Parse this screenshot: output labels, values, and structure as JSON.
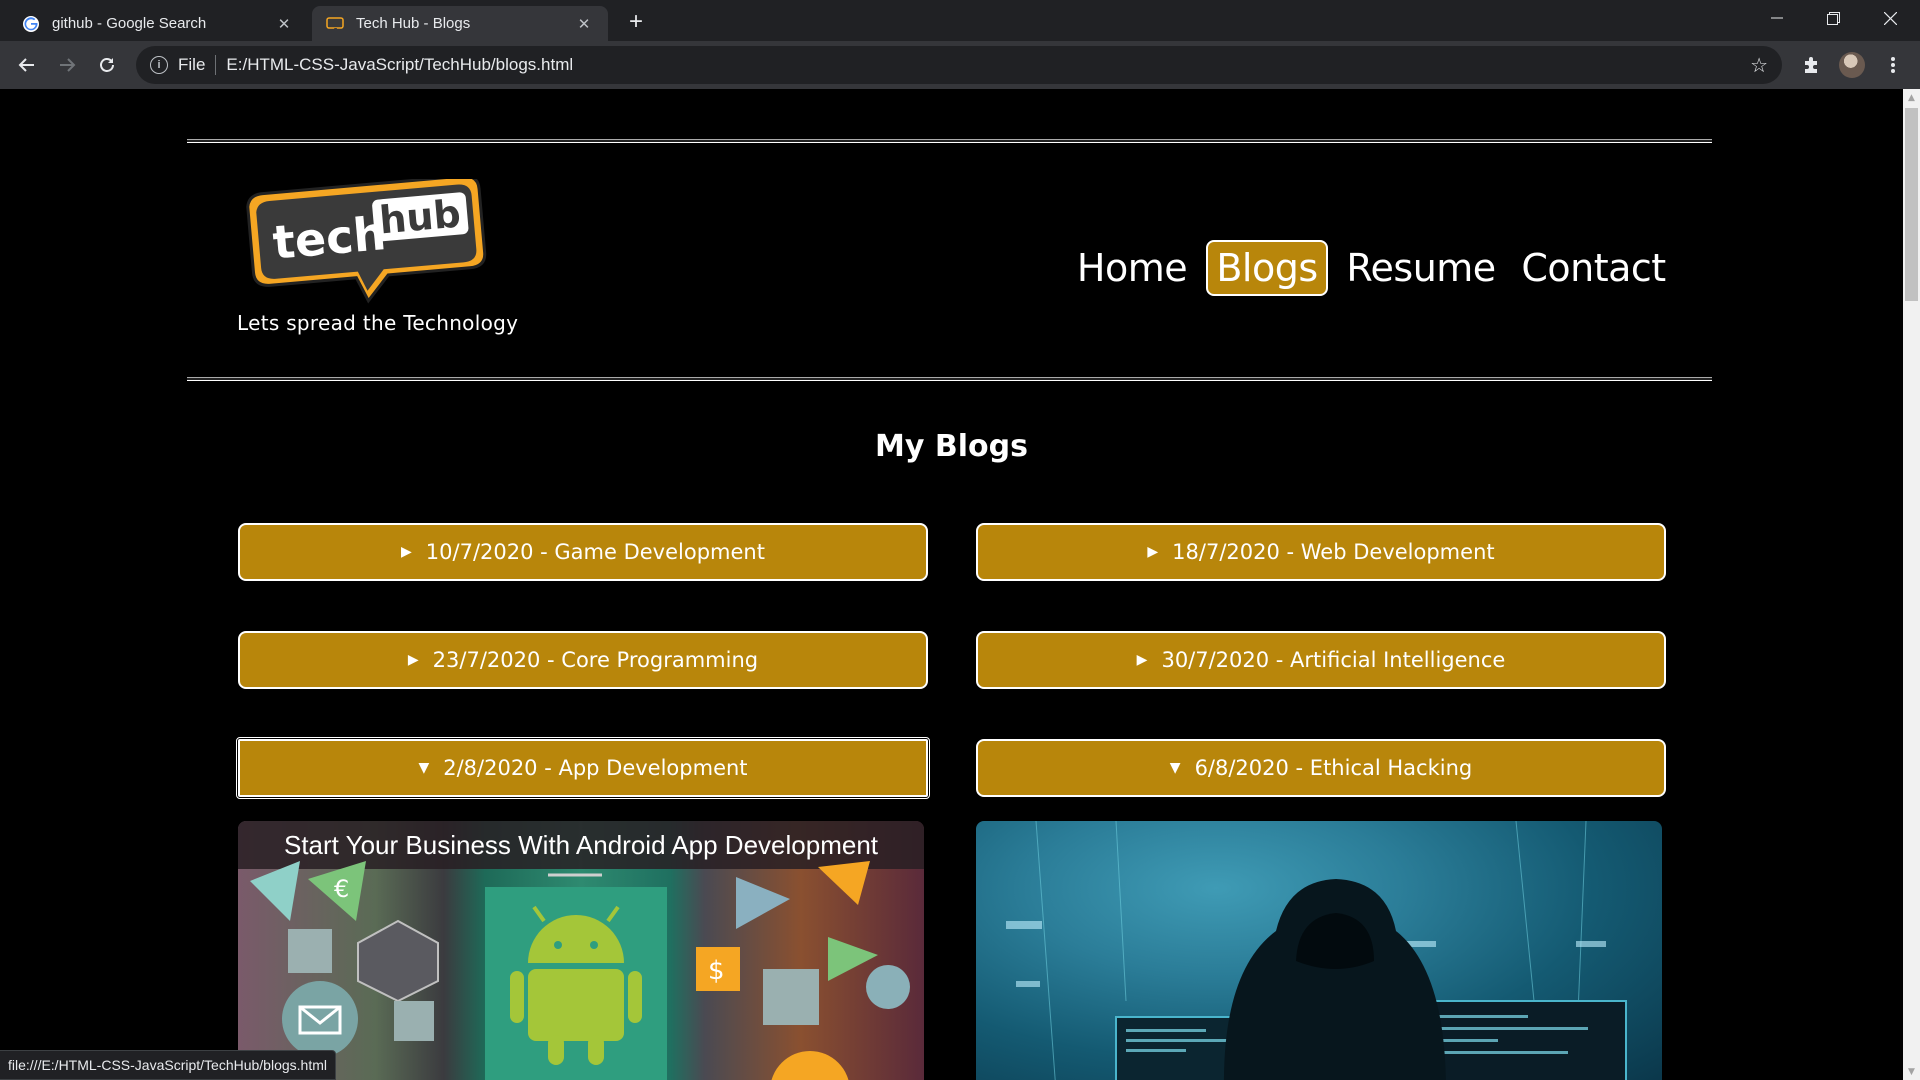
{
  "browser": {
    "tabs": [
      {
        "title": "github - Google Search",
        "active": false,
        "icon": "google-icon"
      },
      {
        "title": "Tech Hub - Blogs",
        "active": true,
        "icon": "techhub-favicon"
      }
    ],
    "address": {
      "scheme": "File",
      "url": "E:/HTML-CSS-JavaScript/TechHub/blogs.html"
    },
    "status_url": "file:///E:/HTML-CSS-JavaScript/TechHub/blogs.html"
  },
  "site": {
    "logo_text_a": "tech",
    "logo_text_b": "hub",
    "tagline": "Lets spread the Technology"
  },
  "nav": {
    "items": [
      {
        "label": "Home",
        "active": false
      },
      {
        "label": "Blogs",
        "active": true
      },
      {
        "label": "Resume",
        "active": false
      },
      {
        "label": "Contact",
        "active": false
      }
    ]
  },
  "main": {
    "heading": "My Blogs",
    "blogs": [
      {
        "label": "10/7/2020 - Game Development",
        "expanded": false
      },
      {
        "label": "18/7/2020 - Web Development",
        "expanded": false
      },
      {
        "label": "23/7/2020 - Core Programming",
        "expanded": false
      },
      {
        "label": "30/7/2020 - Artificial Intelligence",
        "expanded": false
      },
      {
        "label": "2/8/2020 - App Development",
        "expanded": true
      },
      {
        "label": "6/8/2020 - Ethical Hacking",
        "expanded": true
      }
    ],
    "images": {
      "android_caption": "Start Your Business With Android App Development"
    }
  },
  "colors": {
    "accent": "#b8860b",
    "logo_yellow": "#f5a623",
    "logo_dark": "#3a3a3a",
    "page_bg": "#000000"
  }
}
